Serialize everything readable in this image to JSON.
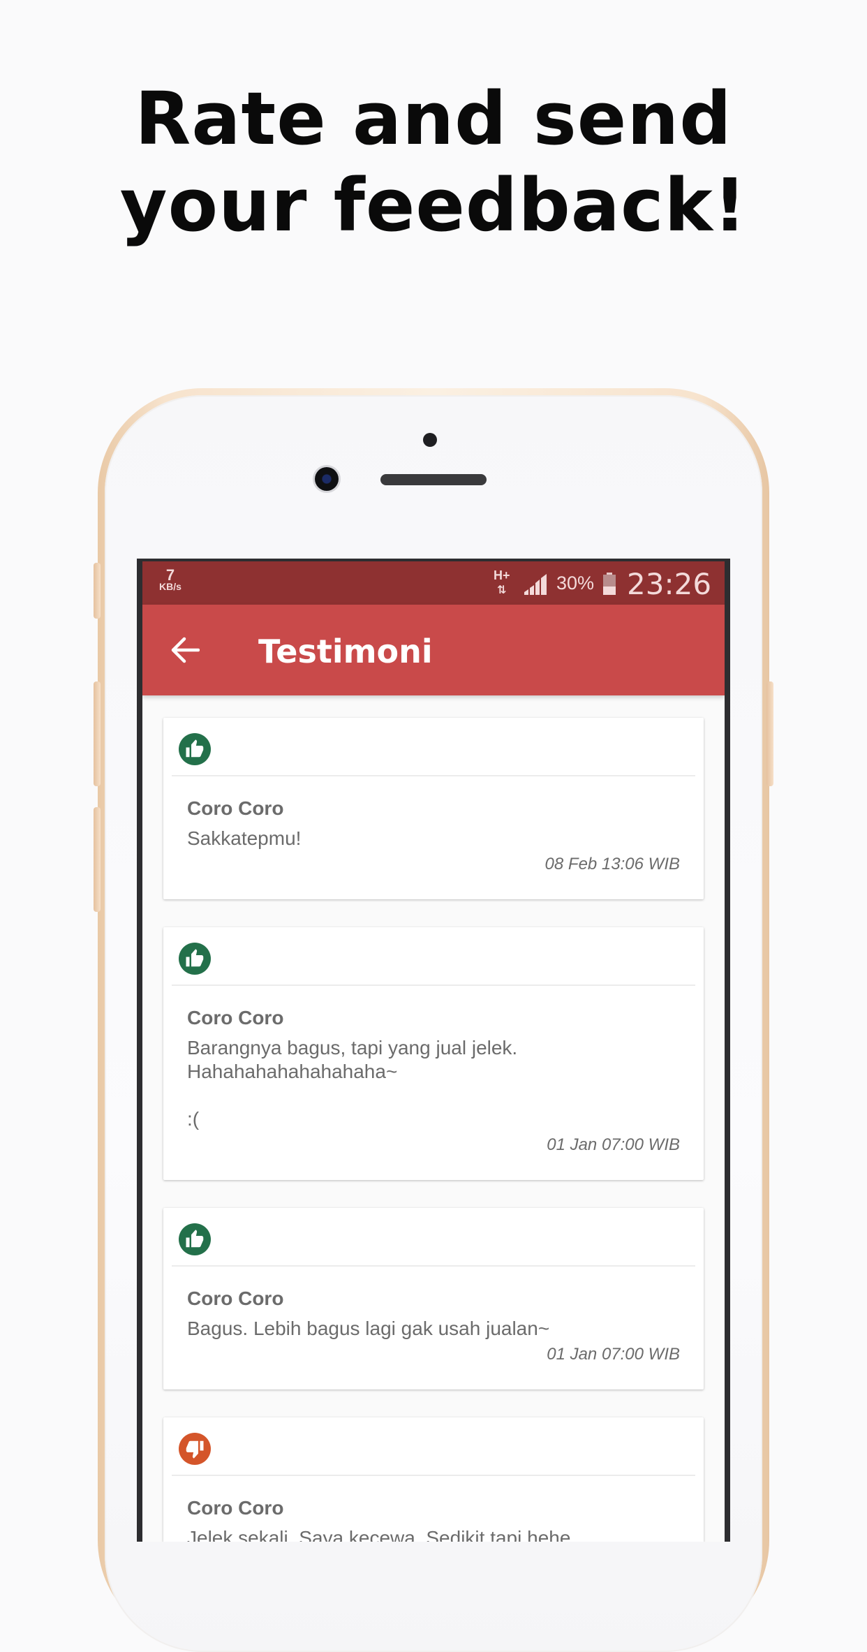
{
  "headline": {
    "line1": "Rate and send",
    "line2": "your feedback!"
  },
  "status_bar": {
    "speed_value": "7",
    "speed_unit": "KB/s",
    "network": "H+",
    "battery_percent": "30%",
    "time": "23:26"
  },
  "app_bar": {
    "title": "Testimoni"
  },
  "testimonials": [
    {
      "rating": "positive",
      "icon": "thumbs-up-icon",
      "name": "Coro Coro",
      "message": "Sakkatepmu!",
      "date": "08 Feb 13:06 WIB"
    },
    {
      "rating": "positive",
      "icon": "thumbs-up-icon",
      "name": "Coro Coro",
      "message": "Barangnya bagus, tapi yang jual jelek.\nHahahahahahahahaha~\n\n:(",
      "date": "01 Jan 07:00 WIB"
    },
    {
      "rating": "positive",
      "icon": "thumbs-up-icon",
      "name": "Coro Coro",
      "message": "Bagus. Lebih bagus lagi gak usah jualan~",
      "date": "01 Jan 07:00 WIB"
    },
    {
      "rating": "negative",
      "icon": "thumbs-down-icon",
      "name": "Coro Coro",
      "message": "Jelek sekali. Saya kecewa. Sedikit tapi hehe",
      "date": ""
    }
  ],
  "colors": {
    "status_bar": "#8e3131",
    "app_bar": "#c94a4a",
    "positive": "#23704a",
    "negative": "#d4552a"
  }
}
